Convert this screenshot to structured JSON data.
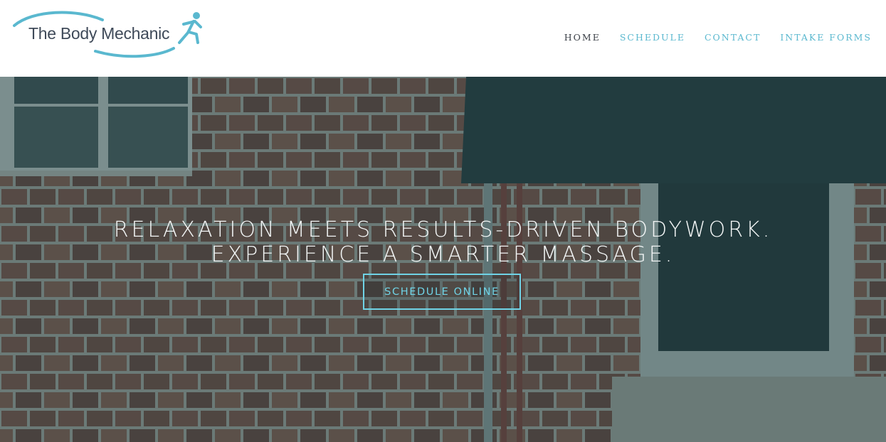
{
  "brand": {
    "name": "The Body Mechanic",
    "accent_color": "#5ab8cf",
    "text_color": "#3f4a59",
    "logo_icon": "running-figure-icon"
  },
  "nav": {
    "items": [
      {
        "label": "HOME",
        "active": true
      },
      {
        "label": "SCHEDULE",
        "active": false
      },
      {
        "label": "CONTACT",
        "active": false
      },
      {
        "label": "INTAKE FORMS",
        "active": false
      }
    ]
  },
  "hero": {
    "headline_line1": "RELAXATION MEETS RESULTS-DRIVEN BODYWORK.",
    "headline_line2": "EXPERIENCE A SMARTER MASSAGE.",
    "cta_label": "SCHEDULE ONLINE",
    "cta_color": "#6fd3e6",
    "background": "brick-wall-photo"
  }
}
